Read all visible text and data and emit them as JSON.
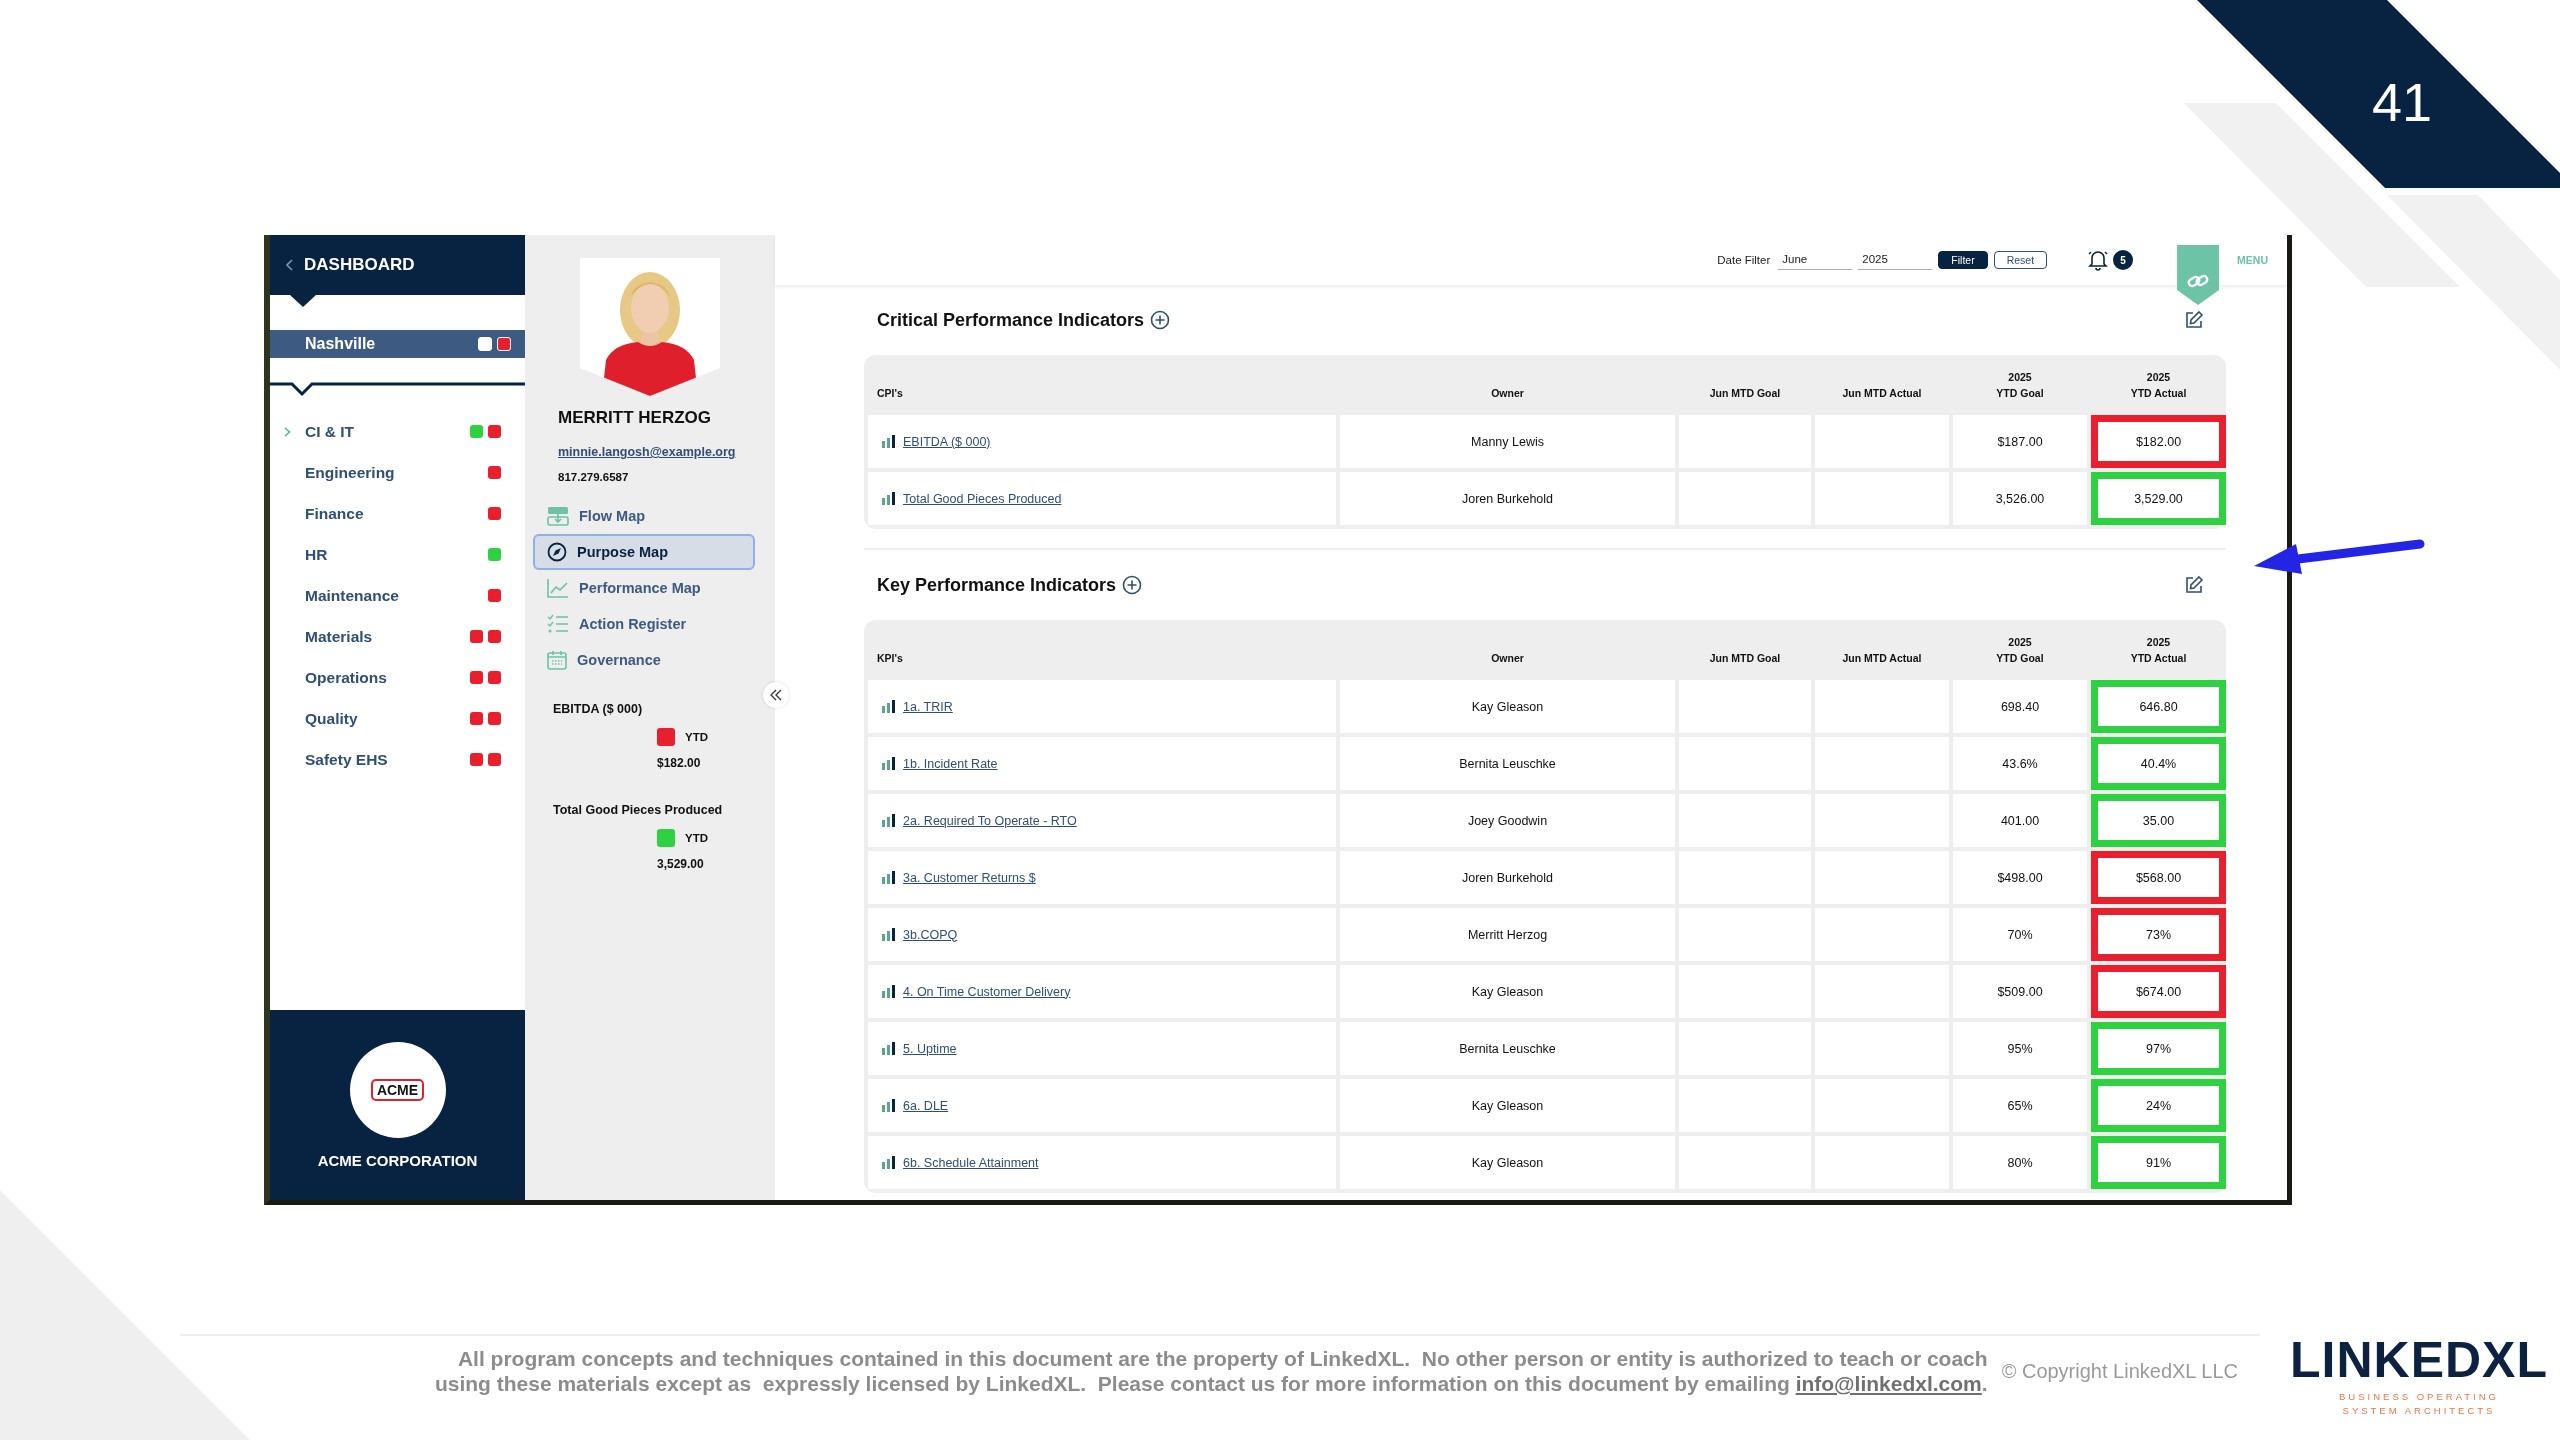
{
  "slide": {
    "number": "41"
  },
  "sidebar": {
    "header": "DASHBOARD",
    "location": {
      "name": "Nashville",
      "dots": [
        {
          "color": "#ffffff"
        },
        {
          "color": "#e8202e"
        }
      ]
    },
    "items": [
      {
        "label": "CI & IT",
        "expanded": false,
        "dots": [
          {
            "color": "#2ed13f"
          },
          {
            "color": "#e8202e"
          }
        ]
      },
      {
        "label": "Engineering",
        "dots": [
          {
            "color": "#e8202e"
          }
        ]
      },
      {
        "label": "Finance",
        "dots": [
          {
            "color": "#e8202e"
          }
        ]
      },
      {
        "label": "HR",
        "dots": [
          {
            "color": "#2ed13f"
          }
        ]
      },
      {
        "label": "Maintenance",
        "dots": [
          {
            "color": "#e8202e"
          }
        ]
      },
      {
        "label": "Materials",
        "dots": [
          {
            "color": "#e8202e"
          },
          {
            "color": "#e8202e"
          }
        ]
      },
      {
        "label": "Operations",
        "dots": [
          {
            "color": "#e8202e"
          },
          {
            "color": "#e8202e"
          }
        ]
      },
      {
        "label": "Quality",
        "dots": [
          {
            "color": "#e8202e"
          },
          {
            "color": "#e8202e"
          }
        ]
      },
      {
        "label": "Safety EHS",
        "dots": [
          {
            "color": "#e8202e"
          },
          {
            "color": "#e8202e"
          }
        ]
      }
    ],
    "company": {
      "logo_text": "ACME",
      "name": "ACME CORPORATION"
    }
  },
  "profile": {
    "name": "MERRITT HERZOG",
    "email": "minnie.langosh@example.org",
    "phone": "817.279.6587",
    "nav": [
      {
        "label": "Flow Map",
        "kind": "flow",
        "selected": false
      },
      {
        "label": "Purpose Map",
        "kind": "compass",
        "selected": true
      },
      {
        "label": "Performance Map",
        "kind": "chart",
        "selected": false
      },
      {
        "label": "Action Register",
        "kind": "checklist",
        "selected": false
      },
      {
        "label": "Governance",
        "kind": "calendar",
        "selected": false
      }
    ],
    "summary": [
      {
        "title": "EBITDA ($ 000)",
        "color": "#e8202e",
        "period": "YTD",
        "value": "$182.00"
      },
      {
        "title": "Total Good Pieces Produced",
        "color": "#2ed13f",
        "period": "YTD",
        "value": "3,529.00"
      }
    ]
  },
  "topbar": {
    "date_filter_label": "Date Filter",
    "month": "June",
    "year": "2025",
    "filter_button": "Filter",
    "reset_button": "Reset",
    "notifications": "5",
    "menu": "MENU"
  },
  "sections": [
    {
      "title": "Critical Performance Indicators",
      "table": {
        "columns": [
          {
            "label": "CPI's"
          },
          {
            "label": "Owner"
          },
          {
            "label": "Jun MTD Goal"
          },
          {
            "label": "Jun MTD Actual"
          },
          {
            "year": "2025",
            "label": "YTD Goal"
          },
          {
            "year": "2025",
            "label": "YTD Actual"
          }
        ],
        "rows": [
          {
            "name": "EBITDA ($ 000)",
            "owner": "Manny Lewis",
            "ytd_goal": "$187.00",
            "ytd_actual": "$182.00",
            "color": "#e8202e"
          },
          {
            "name": "Total Good Pieces Produced",
            "owner": "Joren Burkehold",
            "ytd_goal": "3,526.00",
            "ytd_actual": "3,529.00",
            "color": "#2ed13f"
          }
        ]
      }
    },
    {
      "title": "Key Performance Indicators",
      "table": {
        "columns": [
          {
            "label": "KPI's"
          },
          {
            "label": "Owner"
          },
          {
            "label": "Jun MTD Goal"
          },
          {
            "label": "Jun MTD Actual"
          },
          {
            "year": "2025",
            "label": "YTD Goal"
          },
          {
            "year": "2025",
            "label": "YTD Actual"
          }
        ],
        "rows": [
          {
            "name": "1a. TRIR",
            "owner": "Kay Gleason",
            "ytd_goal": "698.40",
            "ytd_actual": "646.80",
            "color": "#2ed13f"
          },
          {
            "name": "1b. Incident Rate",
            "owner": "Bernita Leuschke",
            "ytd_goal": "43.6%",
            "ytd_actual": "40.4%",
            "color": "#2ed13f"
          },
          {
            "name": "2a. Required To Operate - RTO",
            "owner": "Joey Goodwin",
            "ytd_goal": "401.00",
            "ytd_actual": "35.00",
            "color": "#2ed13f"
          },
          {
            "name": "3a. Customer Returns $",
            "owner": "Joren Burkehold",
            "ytd_goal": "$498.00",
            "ytd_actual": "$568.00",
            "color": "#e8202e"
          },
          {
            "name": "3b.COPQ",
            "owner": "Merritt Herzog",
            "ytd_goal": "70%",
            "ytd_actual": "73%",
            "color": "#e8202e"
          },
          {
            "name": "4. On Time Customer Delivery",
            "owner": "Kay Gleason",
            "ytd_goal": "$509.00",
            "ytd_actual": "$674.00",
            "color": "#e8202e"
          },
          {
            "name": "5. Uptime",
            "owner": "Bernita Leuschke",
            "ytd_goal": "95%",
            "ytd_actual": "97%",
            "color": "#2ed13f"
          },
          {
            "name": "6a. DLE",
            "owner": "Kay Gleason",
            "ytd_goal": "65%",
            "ytd_actual": "24%",
            "color": "#2ed13f"
          },
          {
            "name": "6b. Schedule Attainment",
            "owner": "Kay Gleason",
            "ytd_goal": "80%",
            "ytd_actual": "91%",
            "color": "#2ed13f"
          }
        ]
      }
    }
  ],
  "footer": {
    "notice_line_1": "All program concepts and techniques contained in this document are the property of LinkedXL.  No other person or entity is authorized to teach or coach",
    "notice_line_2": "using these materials except as  expressly licensed by LinkedXL.  Please contact us for more information on this document by emailing",
    "email": "info@linkedxl.com",
    "email_suffix": ".",
    "copyright": "© Copyright LinkedXL LLC",
    "brand": {
      "wordmark": "LINKEDXL",
      "tagline_1": "BUSINESS OPERATING",
      "tagline_2": "SYSTEM ARCHITECTS"
    }
  }
}
